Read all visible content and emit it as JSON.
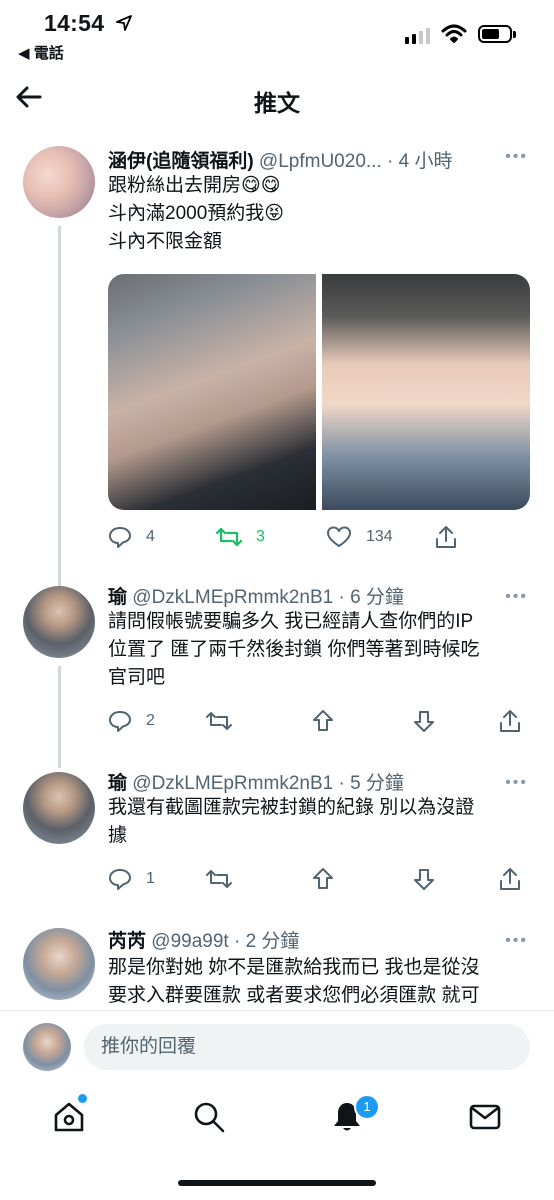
{
  "status_bar": {
    "time": "14:54",
    "back_app": "◀ 電話"
  },
  "header": {
    "title": "推文"
  },
  "main_tweet": {
    "name": "涵伊(追隨領福利)",
    "handle_time": " @LpfmU020... · 4 小時",
    "lines": [
      "跟粉絲出去開房😋😋",
      "斗內滿2000預約我😝",
      "斗內不限金額"
    ],
    "replies": "4",
    "retweets": "3",
    "likes": "134"
  },
  "replies": [
    {
      "name": "瑜",
      "handle_time": " @DzkLMEpRmmk2nB1 · 6 分鐘",
      "lines": [
        "請問假帳號要騙多久 我已經請人查你們的IP",
        "位置了 匯了兩千然後封鎖 你們等著到時候吃",
        "官司吧"
      ],
      "reply_count": "2"
    },
    {
      "name": "瑜",
      "handle_time": " @DzkLMEpRmmk2nB1 · 5 分鐘",
      "lines": [
        "我還有截圖匯款完被封鎖的紀錄 別以為沒證",
        "據"
      ],
      "reply_count": "1"
    },
    {
      "name": "芮芮",
      "handle_time": " @99a99t · 2 分鐘",
      "lines": [
        "那是你對她 妳不是匯款給我而已 我也是從沒",
        "要求入群要匯款 或者要求您們必須匯款 就可"
      ]
    }
  ],
  "reply_bar": {
    "placeholder": "推你的回覆"
  },
  "tab_bar": {
    "notification_count": "1"
  },
  "colors": {
    "accent": "#1d9bf0",
    "retweet": "#17bf63",
    "muted": "#536471"
  },
  "icons": [
    "location-arrow-icon",
    "signal-icon",
    "wifi-icon",
    "battery-icon",
    "back-arrow-icon",
    "more-icon",
    "reply-icon",
    "retweet-icon",
    "like-icon",
    "share-icon",
    "upvote-icon",
    "downvote-icon",
    "home-icon",
    "search-icon",
    "bell-icon",
    "mail-icon"
  ]
}
